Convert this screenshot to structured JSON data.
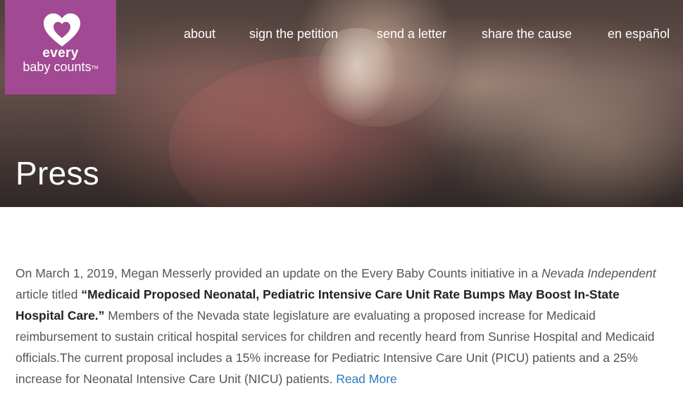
{
  "brand": {
    "line1": "every",
    "line2": "baby counts",
    "trademark": "TM",
    "background_color": "#a14a93"
  },
  "nav": {
    "items": [
      {
        "label": "about"
      },
      {
        "label": "sign the petition"
      },
      {
        "label": "send a letter"
      },
      {
        "label": "share the cause"
      },
      {
        "label": "en español"
      }
    ]
  },
  "hero": {
    "title": "Press"
  },
  "article": {
    "intro": "On March 1, 2019, Megan Messerly provided an update on the Every Baby Counts initiative in a ",
    "publication": "Nevada Independent",
    "after_publication": " article titled ",
    "headline": "“Medicaid Proposed Neonatal, Pediatric Intensive Care Unit Rate Bumps May Boost In-State Hospital Care.”",
    "body": " Members of the Nevada state legislature are evaluating a proposed increase for Medicaid reimbursement to sustain critical hospital services for children and recently heard from Sunrise Hospital and Medicaid officials.The current proposal includes a 15% increase for Pediatric Intensive Care Unit (PICU) patients and a 25%  increase for Neonatal Intensive Care Unit (NICU) patients. ",
    "read_more": "Read More",
    "link_color": "#2f7bbf"
  }
}
